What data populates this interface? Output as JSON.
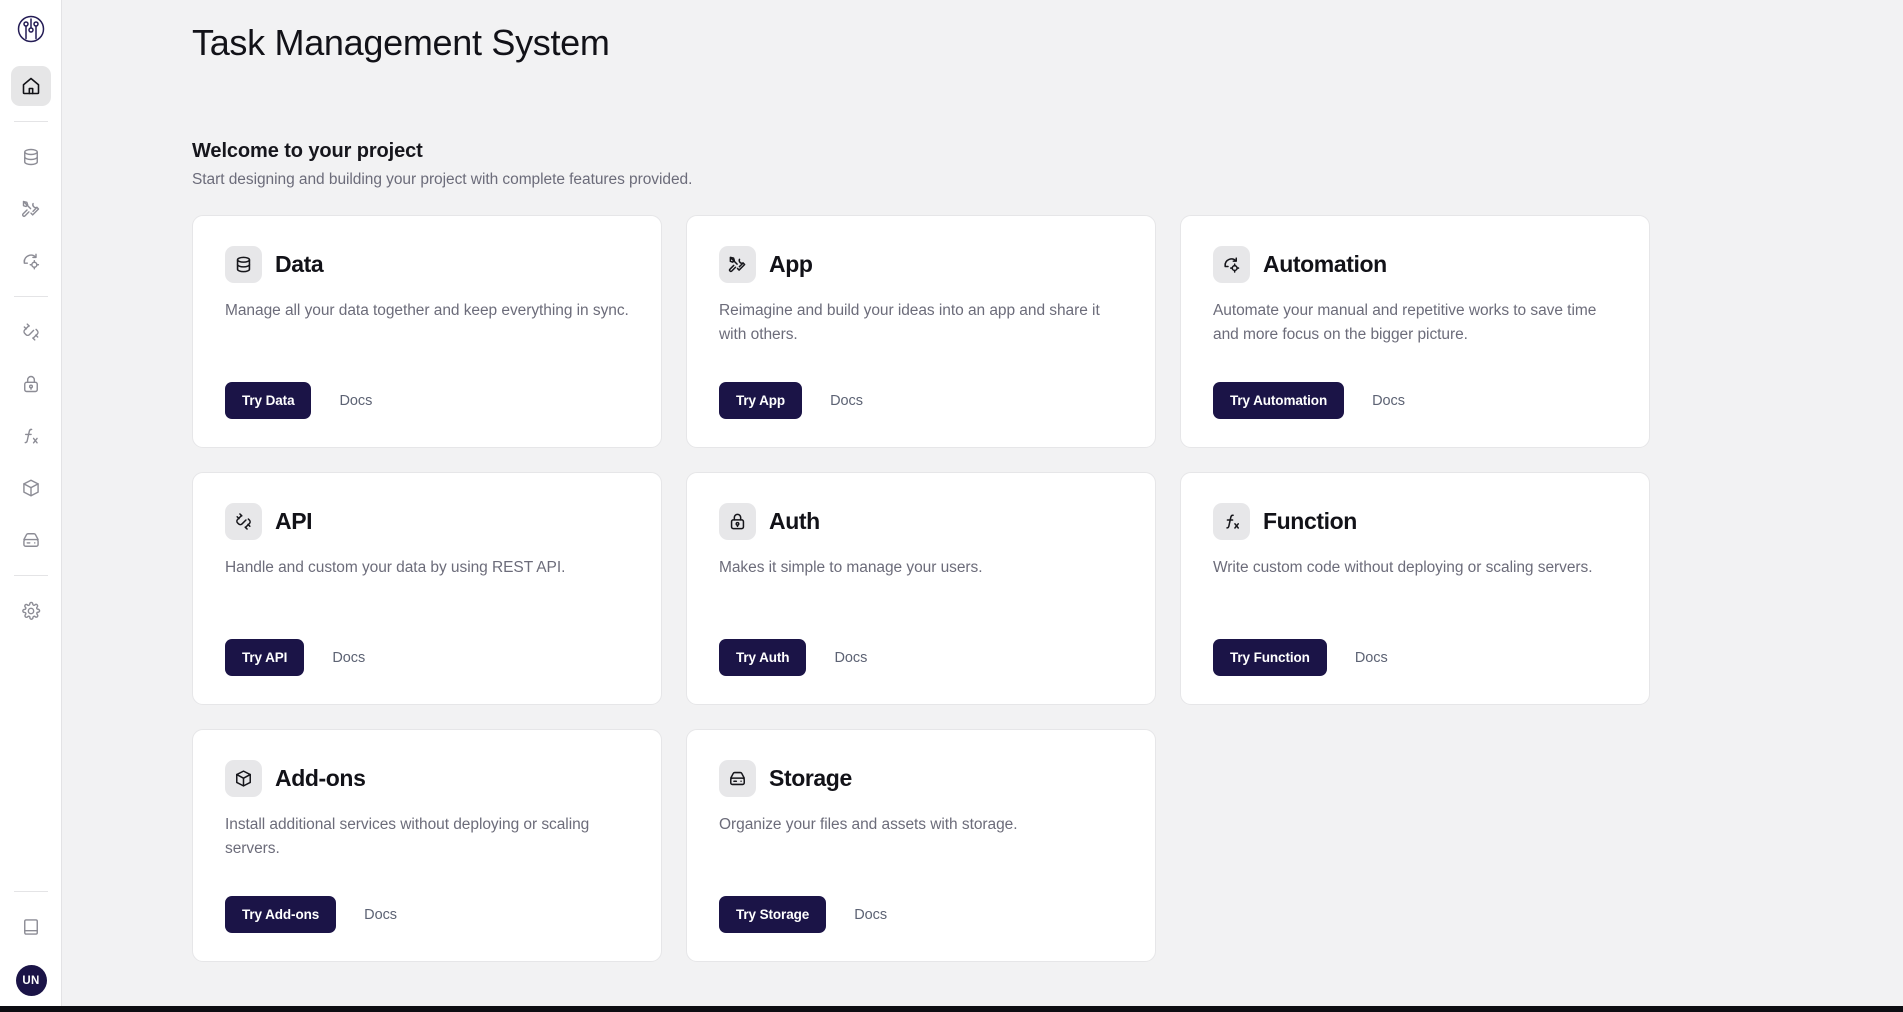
{
  "app": {
    "title": "Task Management System",
    "brand_color": "#1b1447",
    "accent_bg": "#f2f2f3"
  },
  "sidebar": {
    "logo_name": "circuit-logo",
    "items": [
      {
        "name": "home",
        "icon": "home-icon",
        "active": true
      },
      {
        "name": "data",
        "icon": "database-icon",
        "active": false
      },
      {
        "name": "app",
        "icon": "tools-icon",
        "active": false
      },
      {
        "name": "automation",
        "icon": "automation-icon",
        "active": false
      },
      {
        "name": "api",
        "icon": "plug-icon",
        "active": false
      },
      {
        "name": "auth",
        "icon": "lock-icon",
        "active": false
      },
      {
        "name": "function",
        "icon": "function-icon",
        "active": false
      },
      {
        "name": "add-ons",
        "icon": "box-icon",
        "active": false
      },
      {
        "name": "storage",
        "icon": "drive-icon",
        "active": false
      },
      {
        "name": "settings",
        "icon": "gear-icon",
        "active": false
      }
    ],
    "bottom": {
      "docs_icon": "book-icon",
      "avatar_initials": "UN"
    }
  },
  "main": {
    "welcome_heading": "Welcome to your project",
    "welcome_subtitle": "Start designing and building your project with complete features provided.",
    "cards": [
      {
        "icon": "database-icon",
        "title": "Data",
        "description": "Manage all your data together and keep everything in sync.",
        "primary_label": "Try Data",
        "docs_label": "Docs"
      },
      {
        "icon": "tools-icon",
        "title": "App",
        "description": "Reimagine and build your ideas into an app and share it with others.",
        "primary_label": "Try App",
        "docs_label": "Docs"
      },
      {
        "icon": "automation-icon",
        "title": "Automation",
        "description": "Automate your manual and repetitive works to save time and more focus on the bigger picture.",
        "primary_label": "Try Automation",
        "docs_label": "Docs"
      },
      {
        "icon": "plug-icon",
        "title": "API",
        "description": "Handle and custom your data by using REST API.",
        "primary_label": "Try API",
        "docs_label": "Docs"
      },
      {
        "icon": "lock-icon",
        "title": "Auth",
        "description": "Makes it simple to manage your users.",
        "primary_label": "Try Auth",
        "docs_label": "Docs"
      },
      {
        "icon": "function-icon",
        "title": "Function",
        "description": "Write custom code without deploying or scaling servers.",
        "primary_label": "Try Function",
        "docs_label": "Docs"
      },
      {
        "icon": "box-icon",
        "title": "Add-ons",
        "description": "Install additional services without deploying or scaling servers.",
        "primary_label": "Try Add-ons",
        "docs_label": "Docs"
      },
      {
        "icon": "drive-icon",
        "title": "Storage",
        "description": "Organize your files and assets with storage.",
        "primary_label": "Try Storage",
        "docs_label": "Docs"
      }
    ]
  }
}
